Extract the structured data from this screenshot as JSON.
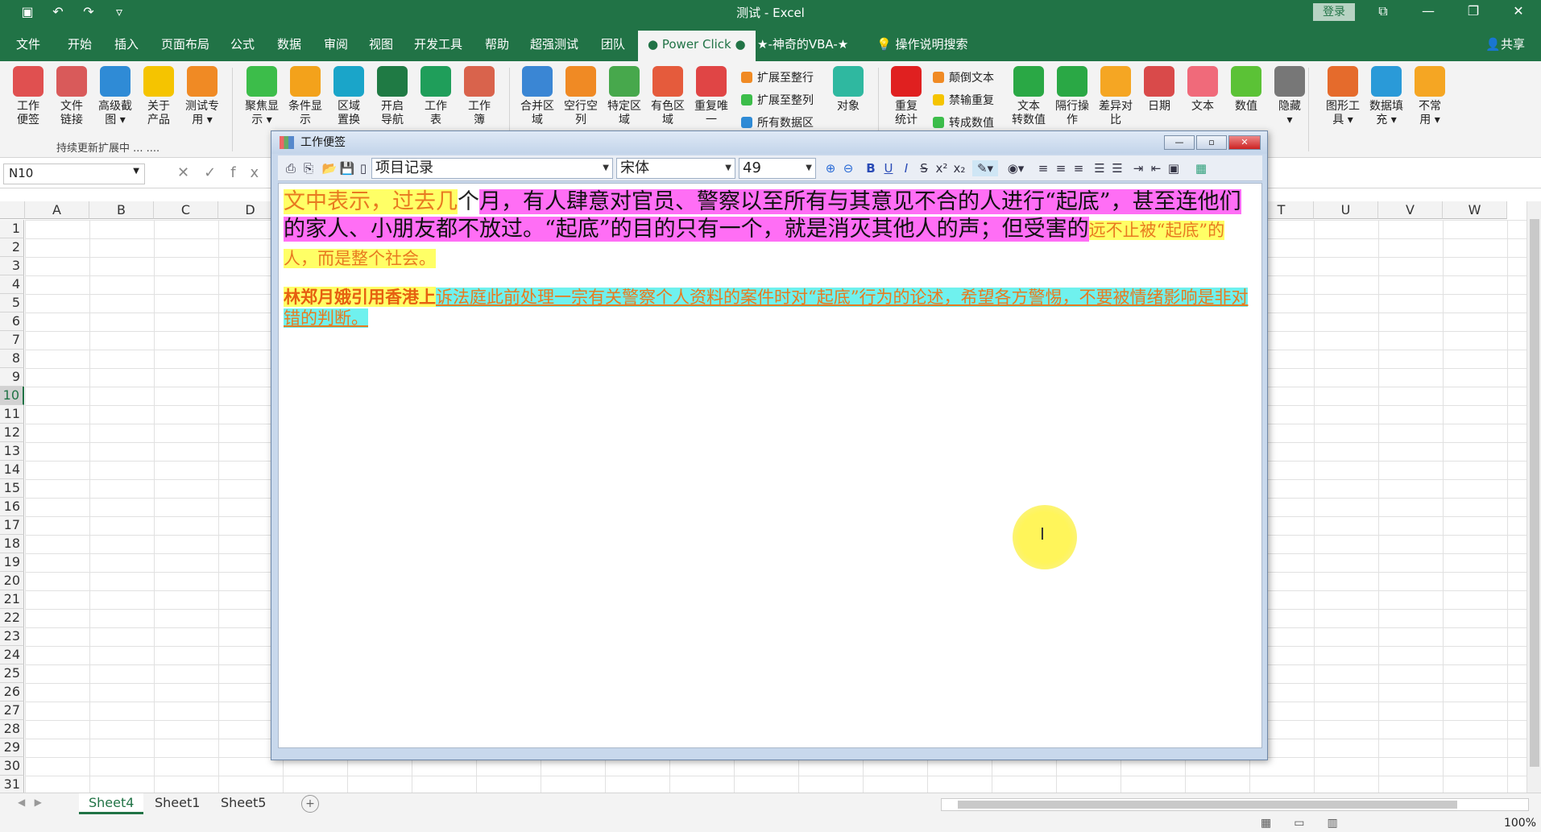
{
  "window": {
    "title": "测试  -  Excel",
    "login_label": "登录"
  },
  "tabs": [
    {
      "label": "文件"
    },
    {
      "label": "开始"
    },
    {
      "label": "插入"
    },
    {
      "label": "页面布局"
    },
    {
      "label": "公式"
    },
    {
      "label": "数据"
    },
    {
      "label": "审阅"
    },
    {
      "label": "视图"
    },
    {
      "label": "开发工具"
    },
    {
      "label": "帮助"
    },
    {
      "label": "超强测试"
    },
    {
      "label": "团队"
    },
    {
      "label": "● Power Click ●"
    },
    {
      "label": "★-神奇的VBA-★"
    },
    {
      "label": "操作说明搜索"
    }
  ],
  "share_label": "共享",
  "ribbon": {
    "buttons": [
      {
        "label": "工作\n便签",
        "color": "#e05050"
      },
      {
        "label": "文件\n链接",
        "color": "#d95a5a"
      },
      {
        "label": "高级截\n图 ▾",
        "color": "#2f8bd6"
      },
      {
        "label": "关于\n产品",
        "color": "#f5c400"
      },
      {
        "label": "测试专\n用 ▾",
        "color": "#f08a24"
      },
      {
        "label": "聚焦显\n示 ▾",
        "color": "#3cbd4a"
      },
      {
        "label": "条件显\n示",
        "color": "#f3a21b"
      },
      {
        "label": "区域\n置换",
        "color": "#1aa5c9"
      },
      {
        "label": "开启\n导航",
        "color": "#1f7a44"
      },
      {
        "label": "工作\n表",
        "color": "#1f9e5a"
      },
      {
        "label": "工作\n簿",
        "color": "#d9634c"
      },
      {
        "label": "合并区\n域",
        "color": "#3a86d4"
      },
      {
        "label": "空行空\n列",
        "color": "#f08a24"
      },
      {
        "label": "特定区\n域",
        "color": "#47a84c"
      },
      {
        "label": "有色区\n域",
        "color": "#e55b3c"
      },
      {
        "label": "重复唯\n一",
        "color": "#e04545"
      },
      {
        "label": "对象",
        "color": "#2fb8a0"
      },
      {
        "label": "重复\n统计",
        "color": "#e02020"
      },
      {
        "label": "文本\n转数值",
        "color": "#2aa845"
      },
      {
        "label": "隔行操\n作",
        "color": "#2aa845"
      },
      {
        "label": "差异对\n比",
        "color": "#f5a623"
      },
      {
        "label": "日期",
        "color": "#d94a4a"
      },
      {
        "label": "文本",
        "color": "#f06a7a"
      },
      {
        "label": "数值",
        "color": "#5bc236"
      },
      {
        "label": "隐藏\n▾",
        "color": "#777777"
      },
      {
        "label": "图形工\n具 ▾",
        "color": "#e56b2c"
      },
      {
        "label": "数据填\n充 ▾",
        "color": "#2a9ad8"
      },
      {
        "label": "不常\n用 ▾",
        "color": "#f5a623"
      }
    ],
    "small_items": [
      {
        "label": "扩展至整行",
        "color": "#f08a24"
      },
      {
        "label": "扩展至整列",
        "color": "#3cbd4a"
      },
      {
        "label": "所有数据区",
        "color": "#2f8bd6"
      },
      {
        "label": "颠倒文本",
        "color": "#f08a24"
      },
      {
        "label": "禁输重复",
        "color": "#f5c400"
      },
      {
        "label": "转成数值",
        "color": "#3cbd4a"
      }
    ],
    "group_label": "持续更新扩展中 ... ...."
  },
  "formula_bar": {
    "name_box": "N10",
    "fx": "fx"
  },
  "columns": [
    "A",
    "B",
    "C",
    "D",
    "T",
    "U",
    "V",
    "W"
  ],
  "rows": [
    "1",
    "2",
    "3",
    "4",
    "5",
    "6",
    "7",
    "8",
    "9",
    "10",
    "11",
    "12",
    "13",
    "14",
    "15",
    "16",
    "17",
    "18",
    "19",
    "20",
    "21",
    "22",
    "23",
    "24",
    "25",
    "26",
    "27",
    "28",
    "29",
    "30",
    "31"
  ],
  "selected_row": "10",
  "sheets": [
    {
      "label": "Sheet4",
      "active": true
    },
    {
      "label": "Sheet1",
      "active": false
    },
    {
      "label": "Sheet5",
      "active": false
    }
  ],
  "zoom": "100%",
  "note_window": {
    "title": "工作便签",
    "record_select": "项目记录",
    "font_select": "宋体",
    "size_select": "49",
    "para1": {
      "seg1": "文中表示，过去几",
      "seg2": "个",
      "seg3": "月，有人肆意对官员、警察以至所有与其意见不合的人进行“起底”，甚至连他们的家人、小朋友都不放过。“起底”的目的只有一个，就是消灭其他人的声；但受害的",
      "seg4": "远不止被“起底”的人，而是整个社会。"
    },
    "para2": {
      "seg1": "林郑月娥引用香港上",
      "seg2": "诉法庭此前处理一宗有关警察个人资料的案件时对“起底”行为的论述，希望各方警惕，不要被情绪影响是非对错的判断。"
    }
  }
}
